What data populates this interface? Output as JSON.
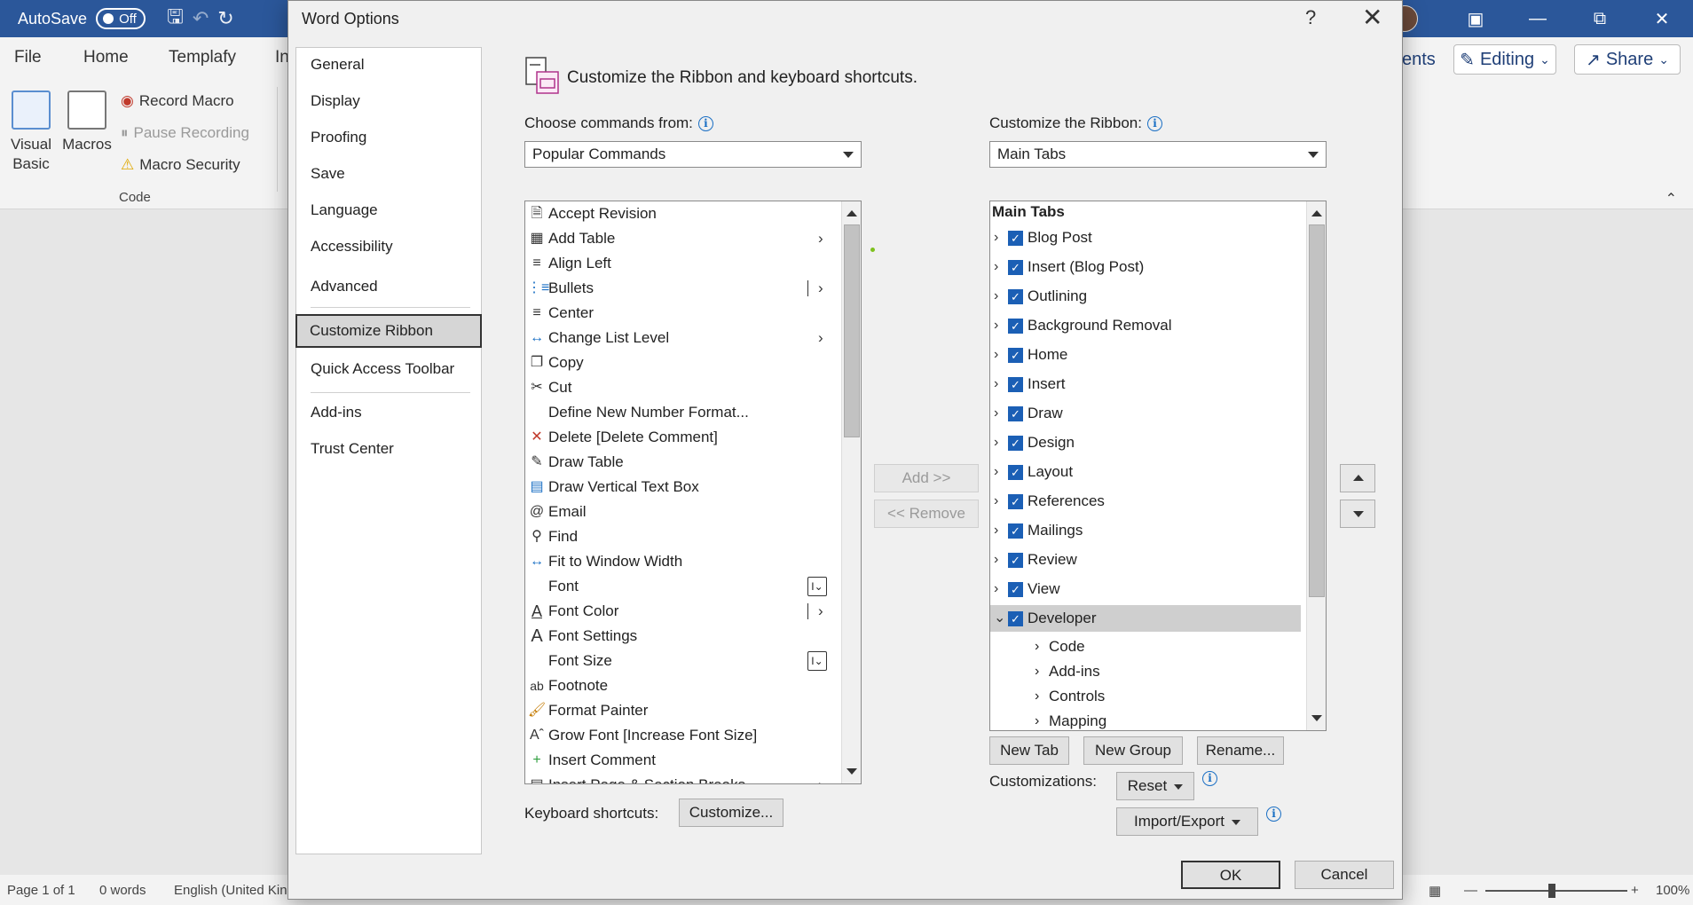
{
  "word": {
    "autosave_label": "AutoSave",
    "autosave_state": "Off",
    "menu": [
      "File",
      "Home",
      "Templafy",
      "In"
    ],
    "comments_fragment": "ents",
    "editing_label": "Editing",
    "share_label": "Share",
    "ribbon": {
      "visual_basic": "Visual Basic",
      "macros": "Macros",
      "record_macro": "Record Macro",
      "pause_recording": "Pause Recording",
      "macro_security": "Macro Security",
      "group_label": "Code"
    },
    "status": {
      "page": "Page 1 of 1",
      "words": "0 words",
      "language": "English (United Kin",
      "zoom": "100%"
    }
  },
  "dialog": {
    "title": "Word Options",
    "help": "?",
    "nav": [
      "General",
      "Display",
      "Proofing",
      "Save",
      "Language",
      "Accessibility",
      "Advanced",
      "Customize Ribbon",
      "Quick Access Toolbar",
      "Add-ins",
      "Trust Center"
    ],
    "selected_nav": "Customize Ribbon",
    "header": "Customize the Ribbon and keyboard shortcuts.",
    "choose_label": "Choose commands from:",
    "choose_value": "Popular Commands",
    "customize_label": "Customize the Ribbon:",
    "customize_value": "Main Tabs",
    "commands": [
      {
        "label": "Accept Revision",
        "icon": "accept-revision-icon"
      },
      {
        "label": "Add Table",
        "icon": "table-icon",
        "submenu": true
      },
      {
        "label": "Align Left",
        "icon": "align-left-icon"
      },
      {
        "label": "Bullets",
        "icon": "bullets-icon",
        "split": true
      },
      {
        "label": "Center",
        "icon": "center-icon"
      },
      {
        "label": "Change List Level",
        "icon": "list-level-icon",
        "submenu": true
      },
      {
        "label": "Copy",
        "icon": "copy-icon"
      },
      {
        "label": "Cut",
        "icon": "scissors-icon"
      },
      {
        "label": "Define New Number Format...",
        "icon": ""
      },
      {
        "label": "Delete [Delete Comment]",
        "icon": "delete-comment-icon"
      },
      {
        "label": "Draw Table",
        "icon": "draw-table-icon"
      },
      {
        "label": "Draw Vertical Text Box",
        "icon": "text-box-icon"
      },
      {
        "label": "Email",
        "icon": "email-icon"
      },
      {
        "label": "Find",
        "icon": "find-icon"
      },
      {
        "label": "Fit to Window Width",
        "icon": "fit-width-icon"
      },
      {
        "label": "Font",
        "icon": "",
        "editbox": true
      },
      {
        "label": "Font Color",
        "icon": "font-color-icon",
        "split": true
      },
      {
        "label": "Font Settings",
        "icon": "font-settings-icon"
      },
      {
        "label": "Font Size",
        "icon": "",
        "editbox": true
      },
      {
        "label": "Footnote",
        "icon": "footnote-icon"
      },
      {
        "label": "Format Painter",
        "icon": "format-painter-icon"
      },
      {
        "label": "Grow Font [Increase Font Size]",
        "icon": "grow-font-icon"
      },
      {
        "label": "Insert Comment",
        "icon": "insert-comment-icon"
      },
      {
        "label": "Insert Page & Section Breaks",
        "icon": "page-break-icon",
        "submenu": true
      }
    ],
    "add_label": "Add >>",
    "remove_label": "<< Remove",
    "tabs_header": "Main Tabs",
    "tabs": [
      {
        "label": "Blog Post",
        "expanded": false
      },
      {
        "label": "Insert (Blog Post)",
        "expanded": false
      },
      {
        "label": "Outlining",
        "expanded": false
      },
      {
        "label": "Background Removal",
        "expanded": false
      },
      {
        "label": "Home",
        "expanded": false
      },
      {
        "label": "Insert",
        "expanded": false
      },
      {
        "label": "Draw",
        "expanded": false
      },
      {
        "label": "Design",
        "expanded": false
      },
      {
        "label": "Layout",
        "expanded": false
      },
      {
        "label": "References",
        "expanded": false
      },
      {
        "label": "Mailings",
        "expanded": false
      },
      {
        "label": "Review",
        "expanded": false
      },
      {
        "label": "View",
        "expanded": false
      },
      {
        "label": "Developer",
        "expanded": true
      }
    ],
    "developer_groups": [
      "Code",
      "Add-ins",
      "Controls",
      "Mapping"
    ],
    "new_tab": "New Tab",
    "new_group": "New Group",
    "rename": "Rename...",
    "customizations_label": "Customizations:",
    "reset": "Reset",
    "import_export": "Import/Export",
    "keyboard_label": "Keyboard shortcuts:",
    "customize_btn": "Customize...",
    "ok": "OK",
    "cancel": "Cancel"
  },
  "colors": {
    "titlebar": "#2b579a",
    "checkbox": "#1b5fb5",
    "info": "#1a6fc4"
  }
}
